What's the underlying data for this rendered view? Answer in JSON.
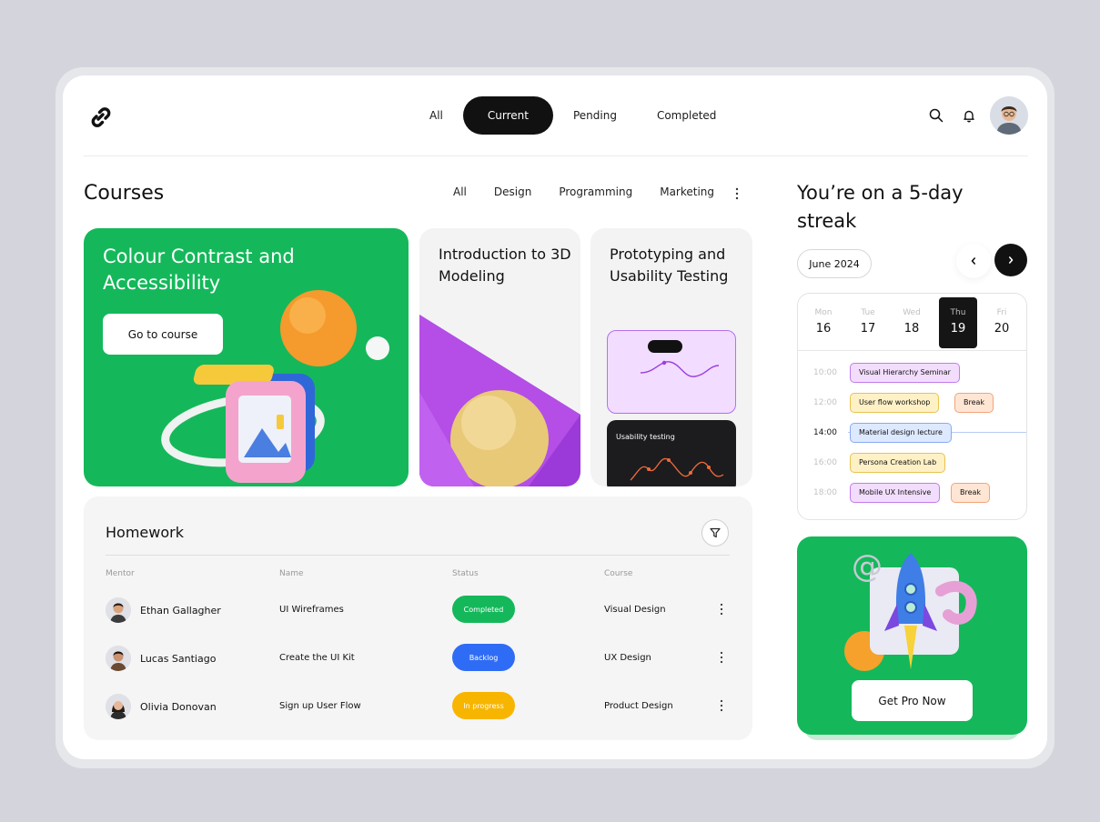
{
  "header": {
    "tabs": [
      {
        "label": "All"
      },
      {
        "label": "Current"
      },
      {
        "label": "Pending"
      },
      {
        "label": "Completed"
      }
    ],
    "active_tab": "Current"
  },
  "courses": {
    "title": "Courses",
    "filters": [
      "All",
      "Design",
      "Programming",
      "Marketing"
    ],
    "cards": [
      {
        "title": "Colour Contrast and Accessibility",
        "button": "Go to course"
      },
      {
        "title": "Introduction to 3D Modeling"
      },
      {
        "title": "Prototyping and Usability Testing",
        "mini_label": "Usability testing"
      }
    ]
  },
  "homework": {
    "title": "Homework",
    "columns": [
      "Mentor",
      "Name",
      "Status",
      "Course"
    ],
    "rows": [
      {
        "mentor": "Ethan Gallagher",
        "name": "UI Wireframes",
        "status": "Completed",
        "course": "Visual Design"
      },
      {
        "mentor": "Lucas Santiago",
        "name": "Create the UI Kit",
        "status": "Backlog",
        "course": "UX Design"
      },
      {
        "mentor": "Olivia Donovan",
        "name": "Sign up User Flow",
        "status": "In progress",
        "course": "Product Design"
      }
    ]
  },
  "streak": {
    "title": "You’re on a 5-day streak",
    "month": "June 2024",
    "days": [
      {
        "name": "Mon",
        "date": "16"
      },
      {
        "name": "Tue",
        "date": "17"
      },
      {
        "name": "Wed",
        "date": "18"
      },
      {
        "name": "Thu",
        "date": "19"
      },
      {
        "name": "Fri",
        "date": "20"
      }
    ],
    "active_day": "19",
    "times": [
      "10:00",
      "12:00",
      "14:00",
      "16:00",
      "18:00"
    ],
    "events": {
      "e1": "Visual Hierarchy Seminar",
      "e2": "User flow workshop",
      "e3": "Break",
      "e4": "Material design lecture",
      "e5": "Persona Creation Lab",
      "e6": "Mobile UX Intensive",
      "e7": "Break"
    }
  },
  "promo": {
    "button": "Get Pro Now"
  },
  "colors": {
    "accent_green": "#14b85a",
    "status_completed": "#14b85a",
    "status_backlog": "#2f6cf5",
    "status_in_progress": "#f7b500"
  }
}
